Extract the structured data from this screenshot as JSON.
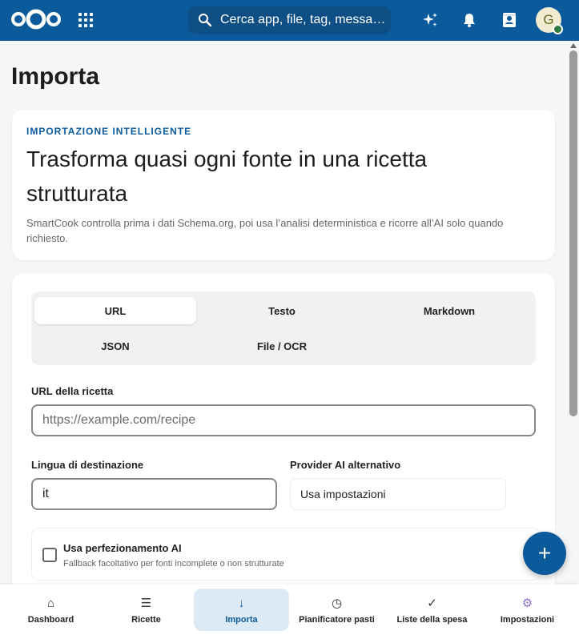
{
  "header": {
    "search_placeholder": "Cerca app, file, tag, messagg...",
    "avatar_initial": "G"
  },
  "page": {
    "title": "Importa"
  },
  "intro": {
    "eyebrow": "IMPORTAZIONE INTELLIGENTE",
    "heading": "Trasforma quasi ogni fonte in una ricetta strutturata",
    "description": "SmartCook controlla prima i dati Schema.org, poi usa l’analisi deterministica e ricorre all’AI solo quando richiesto."
  },
  "tabs": [
    {
      "label": "URL",
      "active": true
    },
    {
      "label": "Testo",
      "active": false
    },
    {
      "label": "Markdown",
      "active": false
    },
    {
      "label": "JSON",
      "active": false
    },
    {
      "label": "File / OCR",
      "active": false
    }
  ],
  "form": {
    "url_label": "URL della ricetta",
    "url_placeholder": "https://example.com/recipe",
    "lang_label": "Lingua di destinazione",
    "lang_value": "it",
    "provider_label": "Provider AI alternativo",
    "provider_value": "Usa impostazioni",
    "ai_checkbox_label": "Usa perfezionamento AI",
    "ai_checkbox_help": "Fallback facoltativo per fonti incomplete o non strutturate",
    "ai_checked": false
  },
  "fab_label": "+",
  "nav": [
    {
      "label": "Dashboard",
      "icon": "home-icon",
      "glyph": "⌂",
      "active": false
    },
    {
      "label": "Ricette",
      "icon": "list-icon",
      "glyph": "☰",
      "active": false
    },
    {
      "label": "Importa",
      "icon": "arrow-down-icon",
      "glyph": "↓",
      "active": true
    },
    {
      "label": "Pianificatore pasti",
      "icon": "clock-icon",
      "glyph": "◷",
      "active": false
    },
    {
      "label": "Liste della spesa",
      "icon": "check-icon",
      "glyph": "✓",
      "active": false
    },
    {
      "label": "Impostazioni",
      "icon": "gear-icon",
      "glyph": "⚙",
      "active": false
    }
  ],
  "colors": {
    "brand": "#0a5a9c",
    "nav_active_bg": "#dceaf5"
  }
}
